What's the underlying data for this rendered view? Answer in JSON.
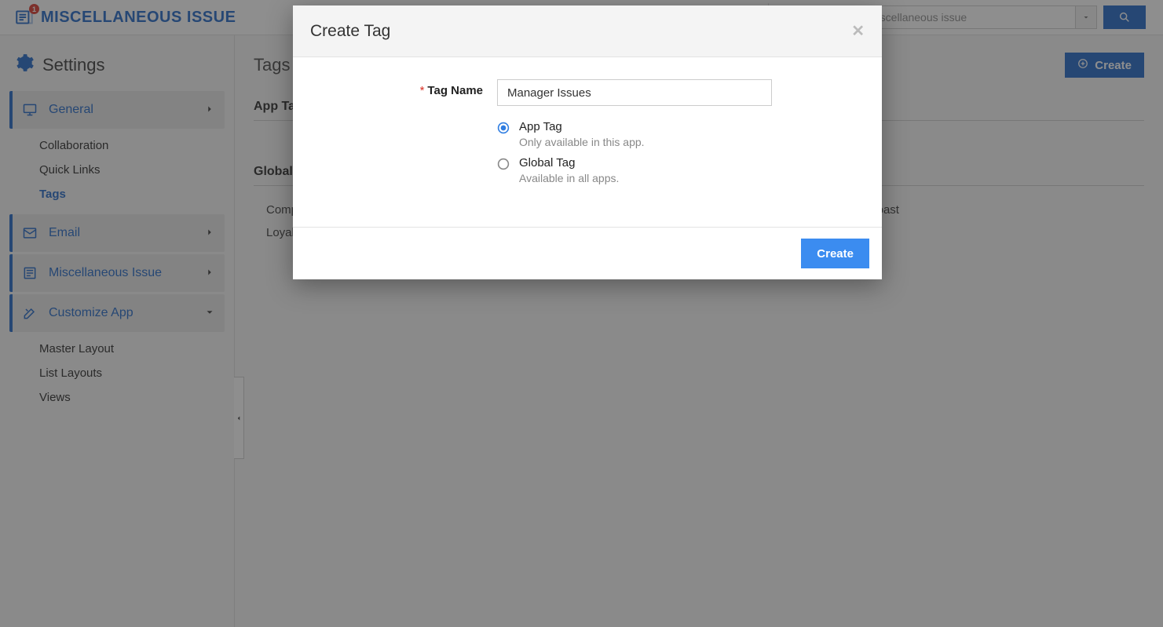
{
  "header": {
    "app_title": "MISCELLANEOUS ISSUE",
    "badge_count": "1",
    "search_placeholder": "search miscellaneous issue"
  },
  "sidebar": {
    "title": "Settings",
    "groups": {
      "general": {
        "label": "General",
        "sub": [
          "Collaboration",
          "Quick Links",
          "Tags"
        ],
        "active_sub_index": 2
      },
      "email": {
        "label": "Email"
      },
      "misc": {
        "label": "Miscellaneous Issue"
      },
      "customize": {
        "label": "Customize App",
        "sub": [
          "Master Layout",
          "List Layouts",
          "Views"
        ]
      }
    }
  },
  "main": {
    "page_title": "Tags",
    "create_label": "Create",
    "sections": {
      "app": {
        "heading": "App Tags"
      },
      "global": {
        "heading": "Global Tags",
        "tags": [
          "Complimentary",
          "East Coast",
          "Loyalty",
          "",
          "",
          ""
        ]
      }
    }
  },
  "modal": {
    "title": "Create Tag",
    "field_label": "Tag Name",
    "field_value": "Manager Issues",
    "options": {
      "app": {
        "title": "App Tag",
        "desc": "Only available in this app."
      },
      "global": {
        "title": "Global Tag",
        "desc": "Available in all apps."
      }
    },
    "selected_option": "app",
    "submit_label": "Create"
  }
}
